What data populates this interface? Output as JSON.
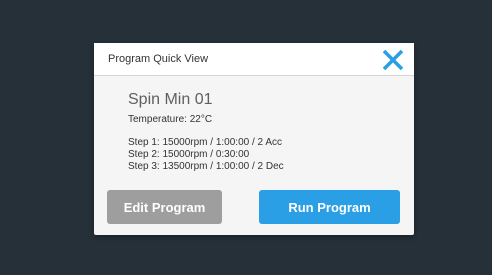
{
  "dialog": {
    "title": "Program Quick View",
    "program_name": "Spin Min 01",
    "temperature": "Temperature: 22°C",
    "steps": [
      "Step 1: 15000rpm / 1:00:00 / 2 Acc",
      "Step 2: 15000rpm / 0:30:00",
      "Step 3: 13500rpm / 1:00:00 / 2 Dec"
    ],
    "edit_label": "Edit Program",
    "run_label": "Run Program",
    "close_icon": "close-icon"
  },
  "colors": {
    "background": "#263038",
    "accent": "#2a9fe6",
    "secondary_button": "#9e9e9e"
  }
}
